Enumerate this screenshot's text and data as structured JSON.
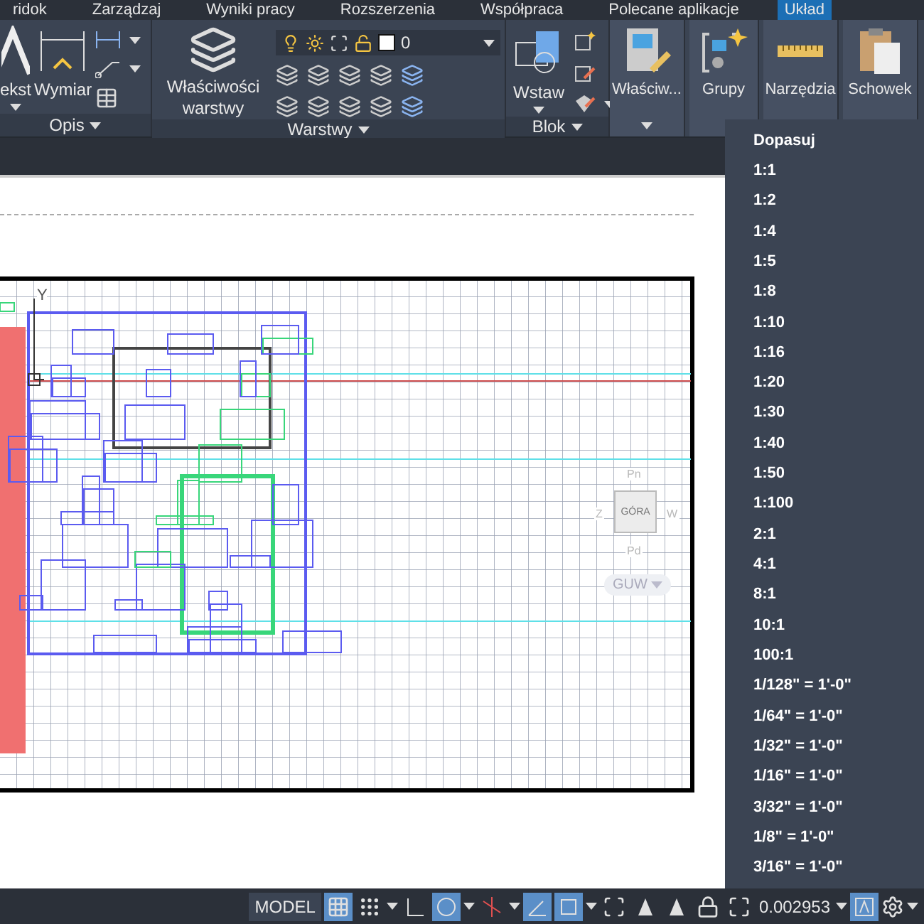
{
  "tabs": [
    {
      "label": "ridok",
      "selected": false
    },
    {
      "label": "Zarządzaj",
      "selected": false
    },
    {
      "label": "Wyniki pracy",
      "selected": false
    },
    {
      "label": "Rozszerzenia",
      "selected": false
    },
    {
      "label": "Współpraca",
      "selected": false
    },
    {
      "label": "Polecane aplikacje",
      "selected": false
    },
    {
      "label": "Układ",
      "selected": true
    }
  ],
  "panels": [
    {
      "kind": "annotate",
      "title": "Opis",
      "buttons": [
        "ekst",
        "Wymiar"
      ]
    },
    {
      "kind": "layers",
      "title": "Warstwy",
      "buttons": [
        "Właściwości warstwy"
      ],
      "layer": "0"
    },
    {
      "kind": "block",
      "title": "Blok",
      "buttons": [
        "Wstaw"
      ]
    },
    {
      "kind": "properties",
      "buttons": [
        "Właściw..."
      ],
      "expandable": true
    },
    {
      "kind": "groups",
      "buttons": [
        "Grupy"
      ]
    },
    {
      "kind": "utilities",
      "buttons": [
        "Narzędzia"
      ]
    },
    {
      "kind": "clipboard",
      "buttons": [
        "Schowek"
      ]
    }
  ],
  "viewcube": {
    "top": "GÓRA",
    "north": "Pn",
    "south": "Pd",
    "west": "Z",
    "east": "W",
    "ucs": "GUW"
  },
  "ucs_axis": "Y",
  "scale_menu": [
    "Dopasuj",
    "1:1",
    "1:2",
    "1:4",
    "1:5",
    "1:8",
    "1:10",
    "1:16",
    "1:20",
    "1:30",
    "1:40",
    "1:50",
    "1:100",
    "2:1",
    "4:1",
    "8:1",
    "10:1",
    "100:1",
    "1/128\" = 1'-0\"",
    "1/64\" = 1'-0\"",
    "1/32\" = 1'-0\"",
    "1/16\" = 1'-0\"",
    "3/32\" = 1'-0\"",
    "1/8\" = 1'-0\"",
    "3/16\" = 1'-0\""
  ],
  "status": {
    "model": "MODEL",
    "scale": "0.002953",
    "toggles": [
      {
        "kind": "grid",
        "on": true
      },
      {
        "kind": "snap",
        "on": false
      },
      {
        "kind": "caret"
      },
      {
        "kind": "ortho",
        "on": false
      },
      {
        "kind": "polar",
        "on": true
      },
      {
        "kind": "caret"
      },
      {
        "kind": "iso",
        "on": false
      },
      {
        "kind": "caret"
      },
      {
        "kind": "dynamic",
        "on": true
      },
      {
        "kind": "lineweight",
        "on": true
      },
      {
        "kind": "caret"
      },
      {
        "kind": "select",
        "on": false
      },
      {
        "kind": "annot",
        "on": false
      },
      {
        "kind": "autoscale",
        "on": false
      },
      {
        "kind": "lock",
        "on": false
      },
      {
        "kind": "full",
        "on": false
      }
    ],
    "annotation_on": true
  }
}
